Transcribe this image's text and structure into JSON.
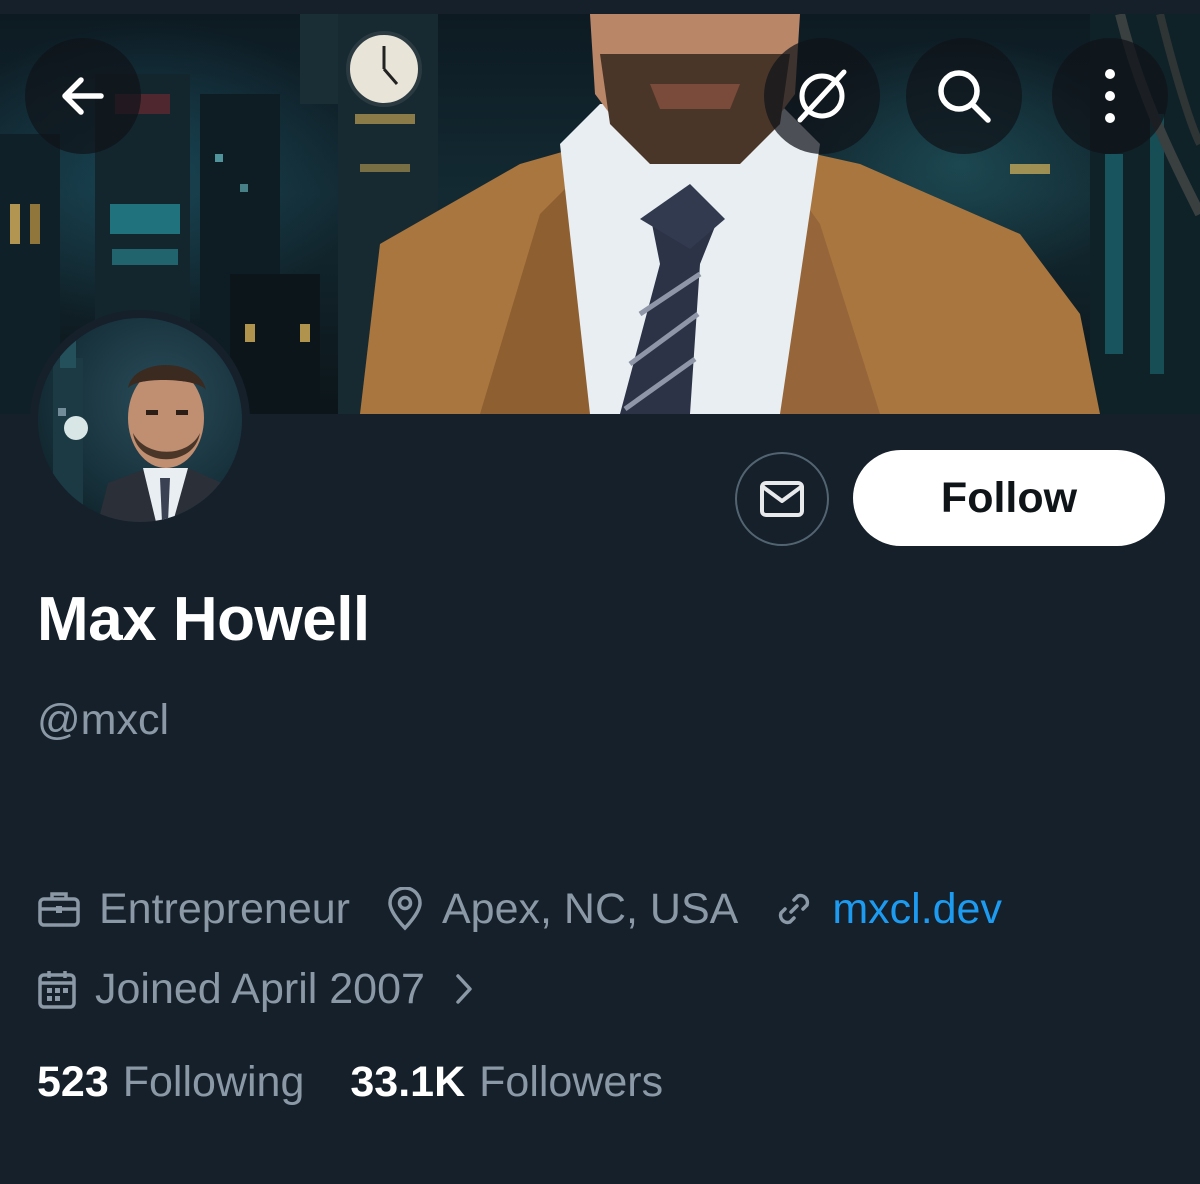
{
  "header": {
    "back_icon": "arrow-left-icon",
    "grok_icon": "grok-icon",
    "search_icon": "search-icon",
    "more_icon": "more-vertical-icon"
  },
  "profile": {
    "name": "Max Howell",
    "handle": "@mxcl",
    "occupation": "Entrepreneur",
    "location": "Apex, NC, USA",
    "website": "mxcl.dev",
    "joined": "Joined April 2007",
    "following_count": "523",
    "following_label": "Following",
    "followers_count": "33.1K",
    "followers_label": "Followers"
  },
  "actions": {
    "follow_label": "Follow",
    "message_icon": "envelope-icon"
  },
  "colors": {
    "background": "#15202b",
    "muted_text": "#8b98a5",
    "link": "#1d9bf0",
    "follow_bg": "#ffffff"
  }
}
